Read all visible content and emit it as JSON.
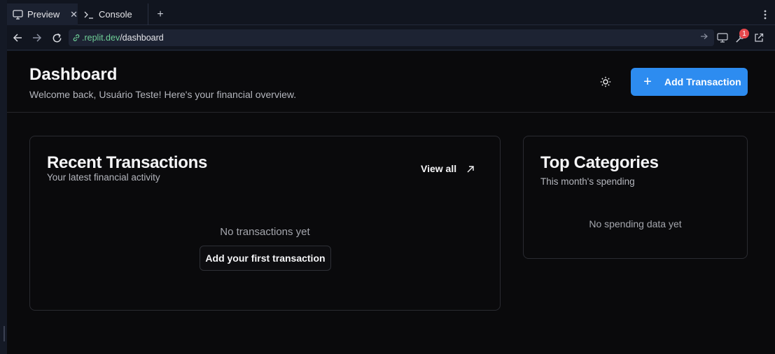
{
  "browser": {
    "tabs": [
      {
        "label": "Preview",
        "icon": "monitor-icon",
        "active": true
      },
      {
        "label": "Console",
        "icon": "terminal-icon",
        "active": false
      }
    ],
    "url": {
      "domain": ".replit.dev",
      "path": "/dashboard"
    },
    "notification_count": "1"
  },
  "header": {
    "title": "Dashboard",
    "subtitle": "Welcome back, Usuário Teste! Here's your financial overview.",
    "add_button_label": "Add Transaction"
  },
  "recent": {
    "title": "Recent Transactions",
    "subtitle": "Your latest financial activity",
    "view_all_label": "View all",
    "empty_text": "No transactions yet",
    "add_first_label": "Add your first transaction"
  },
  "categories": {
    "title": "Top Categories",
    "subtitle": "This month's spending",
    "empty_text": "No spending data yet"
  },
  "colors": {
    "accent": "#2d8cf0",
    "url_domain": "#6fcf97",
    "badge": "#e5484d"
  }
}
